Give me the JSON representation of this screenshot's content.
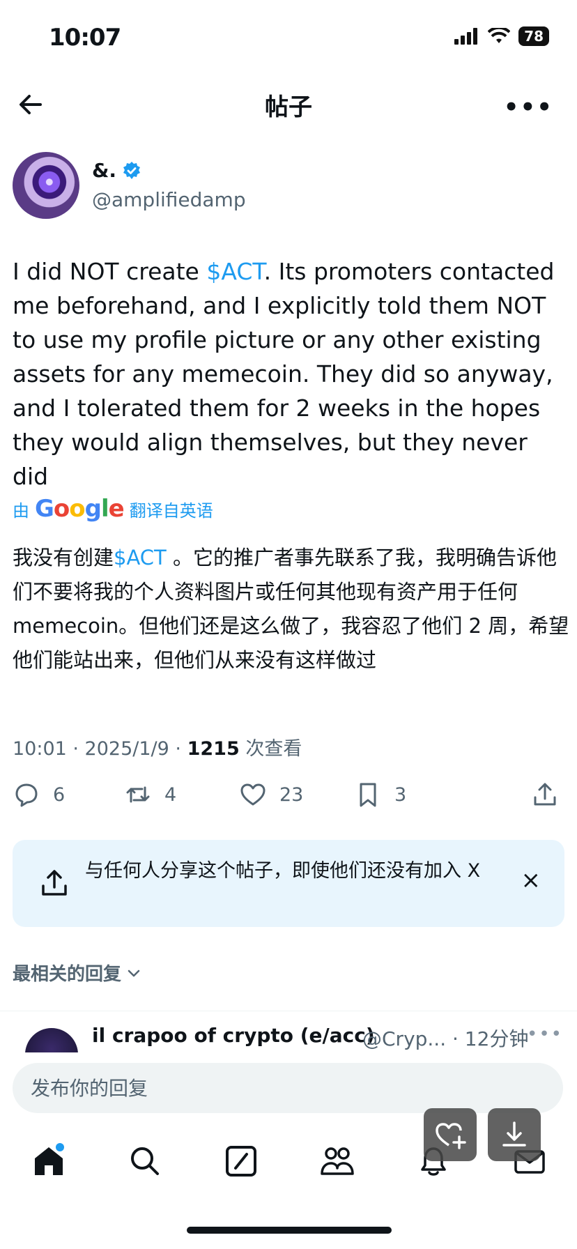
{
  "status_bar": {
    "time": "10:07",
    "battery": "78"
  },
  "header": {
    "title": "帖子"
  },
  "author": {
    "display_name": "&.",
    "handle": "@amplifiedamp"
  },
  "tweet": {
    "text_before_cashtag": "I did NOT create ",
    "cashtag": "$ACT",
    "text_after_cashtag": ". Its promoters contacted me beforehand, and I explicitly told them NOT to use my profile picture or any other existing assets for any memecoin. They did so anyway, and I tolerated them for 2 weeks in the hopes they would align themselves, but they never did"
  },
  "translation": {
    "prefix": "由",
    "provider": "Google",
    "suffix": "翻译自英语",
    "text_before_cashtag": "我没有创建",
    "cashtag": "$ACT",
    "text_after_cashtag": " 。它的推广者事先联系了我，我明确告诉他们不要将我的个人资料图片或任何其他现有资产用于任何 memecoin。但他们还是这么做了，我容忍了他们 2 周，希望他们能站出来，但他们从来没有这样做过"
  },
  "meta": {
    "timestamp": "10:01 · 2025/1/9 · ",
    "views_count": "1215",
    "views_label": " 次查看"
  },
  "actions": {
    "replies": "6",
    "retweets": "4",
    "likes": "23",
    "bookmarks": "3"
  },
  "share_banner": {
    "text": "与任何人分享这个帖子，即使他们还没有加入 X",
    "close": "×"
  },
  "replies_section": {
    "sort_label": "最相关的回复"
  },
  "reply_preview": {
    "name": "il crapoo of crypto (e/acc)",
    "handle_and_time": "@Cryp... · 12分钟"
  },
  "composer": {
    "placeholder": "发布你的回复"
  },
  "colors": {
    "accent": "#1d9bf0",
    "secondary_text": "#536471",
    "share_banner_bg": "#e8f5fd"
  },
  "bottom_nav": {
    "items": [
      "home-icon",
      "search-icon",
      "compose-icon",
      "communities-icon",
      "notifications-icon",
      "messages-icon"
    ]
  }
}
